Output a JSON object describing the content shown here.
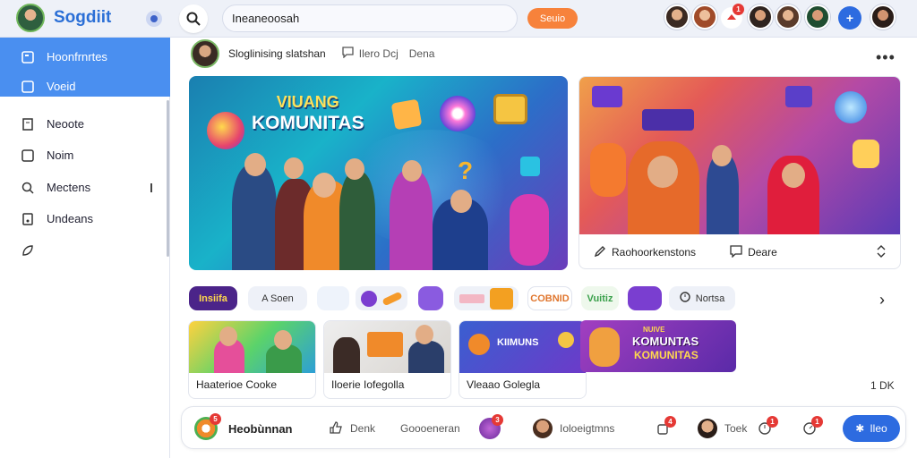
{
  "app": {
    "brand": "Sogdiit"
  },
  "search": {
    "value": "Ineaneoosah",
    "button": "Seuio"
  },
  "header": {
    "avatars": [
      "user-avatar-1",
      "user-avatar-2",
      "user-avatar-3",
      "user-avatar-4",
      "user-avatar-5",
      "user-avatar-6"
    ],
    "notification_count": "1"
  },
  "sidebar": {
    "items": [
      {
        "label": "Hoonfrnrtes",
        "icon": "home-icon"
      },
      {
        "label": "Voeid",
        "icon": "square-icon"
      },
      {
        "label": "Neoote",
        "icon": "building-icon"
      },
      {
        "label": "Noim",
        "icon": "square-icon"
      },
      {
        "label": "Mectens",
        "icon": "search-icon"
      },
      {
        "label": "Undeans",
        "icon": "music-icon"
      },
      {
        "label": "",
        "icon": "leaf-icon"
      }
    ]
  },
  "post": {
    "author_line": "Sloglinising slatshan",
    "meta_label": "Ilero Dcj",
    "meta_tag": "Dena"
  },
  "feature": {
    "headline_top": "VIUANG",
    "headline_main": "KOMUNITAS",
    "right_card_action": "Raohoorkenstons",
    "right_card_secondary": "Deare"
  },
  "chips": [
    "Insiifa",
    "A Soen",
    "",
    "",
    "",
    "",
    "COBNID",
    "Vuitiz",
    "",
    "Nortsa"
  ],
  "thumbnails": [
    {
      "caption": "Haaterioe Cooke"
    },
    {
      "caption": "Iloerie Iofegolla"
    },
    {
      "caption": "Vleaao Golegla"
    },
    {
      "caption": ""
    }
  ],
  "thumb_texts": {
    "t3_top": "KIIMUNS",
    "t4_top": "NUIVE",
    "t4_mid": "KOMUNTAS",
    "t4_bot": "KOMUNITAS"
  },
  "count_label": "1 DK",
  "bottom_bar": {
    "main_label": "Heobùnnan",
    "action1": "Denk",
    "action2": "Goooeneran",
    "action3": "Ioloeigtmns",
    "action4": "Toek",
    "send": "Ileo",
    "badges": [
      "5",
      "3",
      "4",
      "1",
      "1"
    ]
  },
  "colors": {
    "accent": "#2d6be0",
    "sidebar_active": "#4a8ff0",
    "search_button": "#f7823b"
  }
}
